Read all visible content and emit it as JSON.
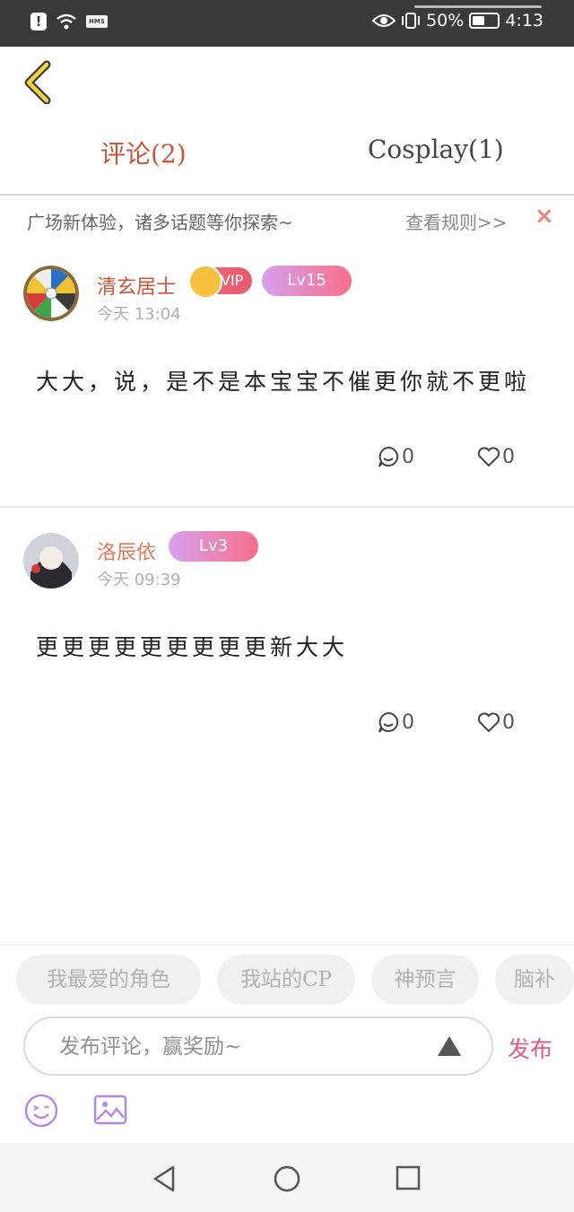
{
  "status_bar": {
    "left_icons": [
      "alert-icon",
      "wifi-icon",
      "hms-icon"
    ],
    "hms_label": "HMS",
    "battery_percent": "50%",
    "time": "4:13"
  },
  "tabs": [
    {
      "label": "评论(2)",
      "active": true
    },
    {
      "label": "Cosplay(1)",
      "active": false
    }
  ],
  "notice": {
    "text": "广场新体验，诸多话题等你探索~",
    "link": "查看规则>>",
    "close": "×"
  },
  "comments": [
    {
      "username": "清玄居士",
      "time": "今天  13:04",
      "vip": "VIP",
      "level": "Lv15",
      "text": "大大，说，是不是本宝宝不催更你就不更啦",
      "comment_count": "0",
      "like_count": "0"
    },
    {
      "username": "洛辰依",
      "time": "今天  09:39",
      "level": "Lv3",
      "text": "更更更更更更更更更新大大",
      "comment_count": "0",
      "like_count": "0"
    }
  ],
  "topic_chips": [
    "我最爱的角色",
    "我站的CP",
    "神预言",
    "脑补"
  ],
  "composer": {
    "placeholder": "发布评论，赢奖励~",
    "publish_label": "发布"
  },
  "colors": {
    "accent_red": "#c9543a",
    "publish_pink": "#e0578a",
    "level_gradient": [
      "#d7a0f0",
      "#f7708a"
    ]
  }
}
